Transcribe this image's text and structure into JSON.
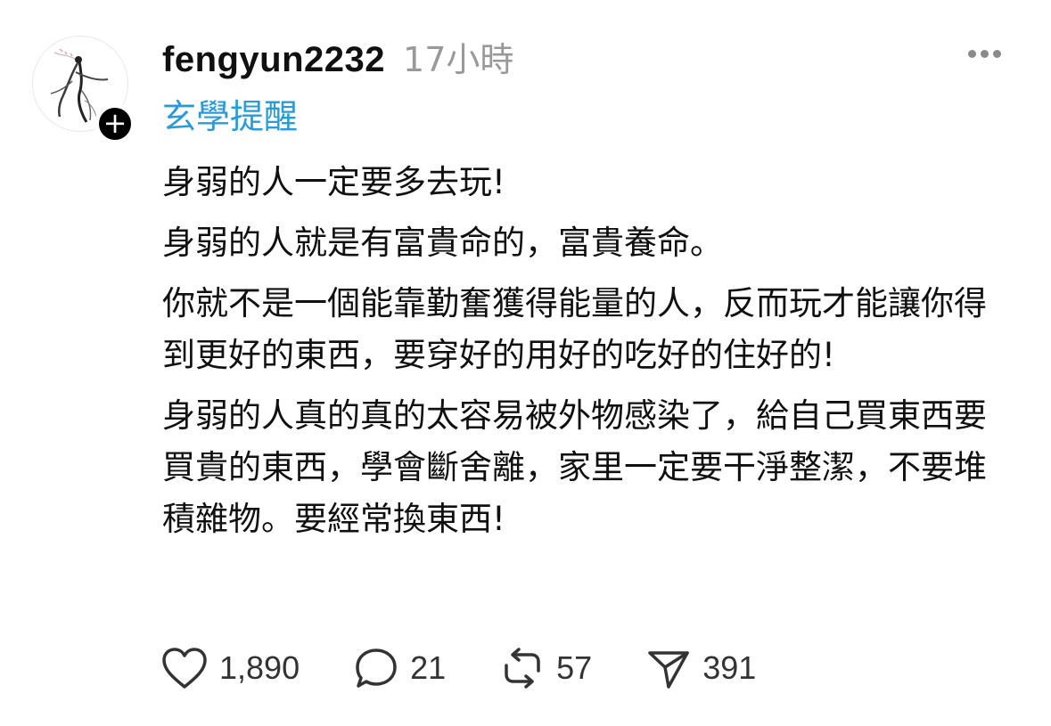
{
  "post": {
    "username": "fengyun2232",
    "timestamp": "17小時",
    "topic": "玄學提醒",
    "follow_symbol": "+",
    "paragraphs": [
      "身弱的人一定要多去玩!",
      "身弱的人就是有富貴命的，富貴養命。",
      "你就不是一個能靠勤奮獲得能量的人，反而玩才能讓你得到更好的東西，要穿好的用好的吃好的住好的!",
      "身弱的人真的真的太容易被外物感染了，給自己買東西要買貴的東西，學會斷舍離，家里一定要干淨整潔，不要堆積雜物。要經常換東西!"
    ],
    "actions": {
      "like_count": "1,890",
      "comment_count": "21",
      "repost_count": "57",
      "share_count": "391"
    }
  },
  "icons": {
    "avatar": "ink-painting-figure-avatar",
    "follow": "plus-icon",
    "more": "more-options-icon",
    "like": "heart-icon",
    "comment": "comment-bubble-icon",
    "repost": "repost-icon",
    "share": "send-icon"
  },
  "colors": {
    "topic": "#2a9ad8",
    "timestamp": "#999999",
    "text": "#101010",
    "icon": "#333333"
  }
}
